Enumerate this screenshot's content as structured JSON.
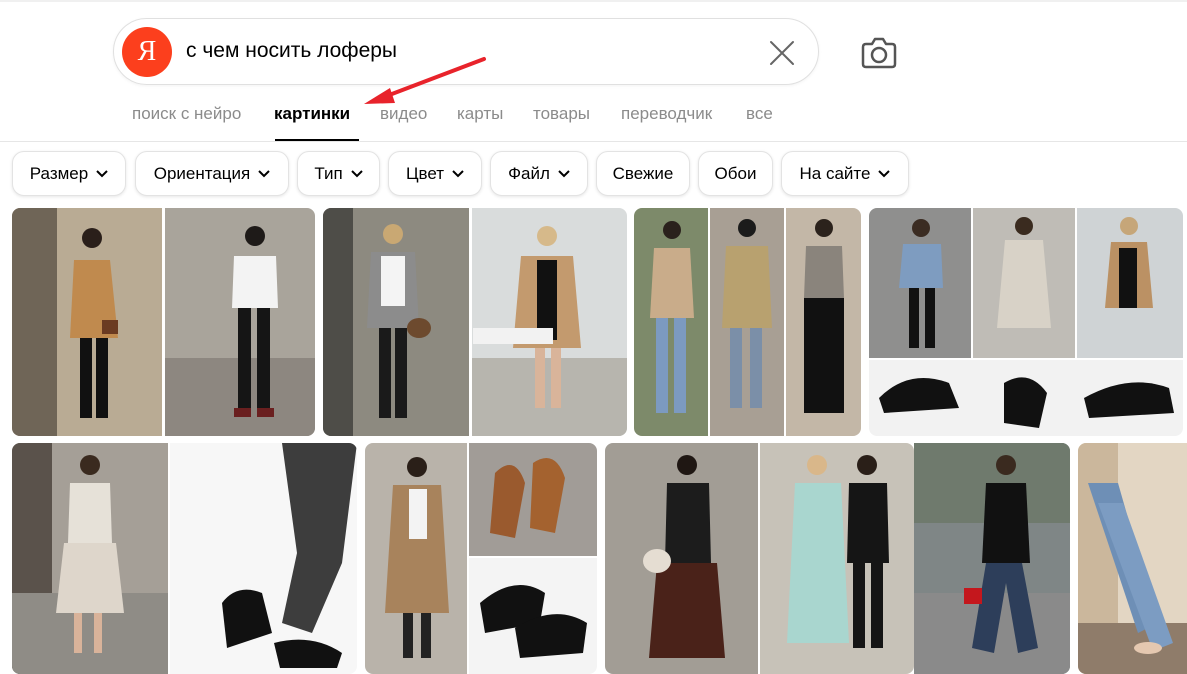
{
  "search": {
    "logo_letter": "Я",
    "query": "с чем носить лоферы"
  },
  "icons": {
    "clear": "close-icon",
    "camera": "camera-icon",
    "filter_arrow": "chevron-down-icon"
  },
  "tabs": [
    {
      "label": "поиск с нейро",
      "active": false
    },
    {
      "label": "картинки",
      "active": true
    },
    {
      "label": "видео",
      "active": false
    },
    {
      "label": "карты",
      "active": false
    },
    {
      "label": "товары",
      "active": false
    },
    {
      "label": "переводчик",
      "active": false
    },
    {
      "label": "все",
      "active": false
    }
  ],
  "filters": [
    {
      "label": "Размер",
      "dropdown": true
    },
    {
      "label": "Ориентация",
      "dropdown": true
    },
    {
      "label": "Тип",
      "dropdown": true
    },
    {
      "label": "Цвет",
      "dropdown": true
    },
    {
      "label": "Файл",
      "dropdown": true
    },
    {
      "label": "Свежие",
      "dropdown": false
    },
    {
      "label": "Обои",
      "dropdown": false
    },
    {
      "label": "На сайте",
      "dropdown": true
    }
  ],
  "colors": {
    "brand": "#fc3f1d",
    "annotation_arrow": "#e8232b",
    "inactive_tab": "#8b8b8b"
  },
  "results": {
    "row1": [
      "loafers-outfit-camel-blazer-collage",
      "loafers-outfit-long-camel-coat-collage",
      "loafers-outfit-three-looks-collage",
      "loafers-outfit-denim-trench-collage"
    ],
    "row2": [
      "loafers-outfit-white-dress-collage",
      "loafers-outfit-brown-and-black-loafers-collage",
      "loafers-outfit-street-style-collage",
      "loafers-outfit-black-top-jeans",
      "loafers-outfit-cropped-jeans"
    ]
  }
}
